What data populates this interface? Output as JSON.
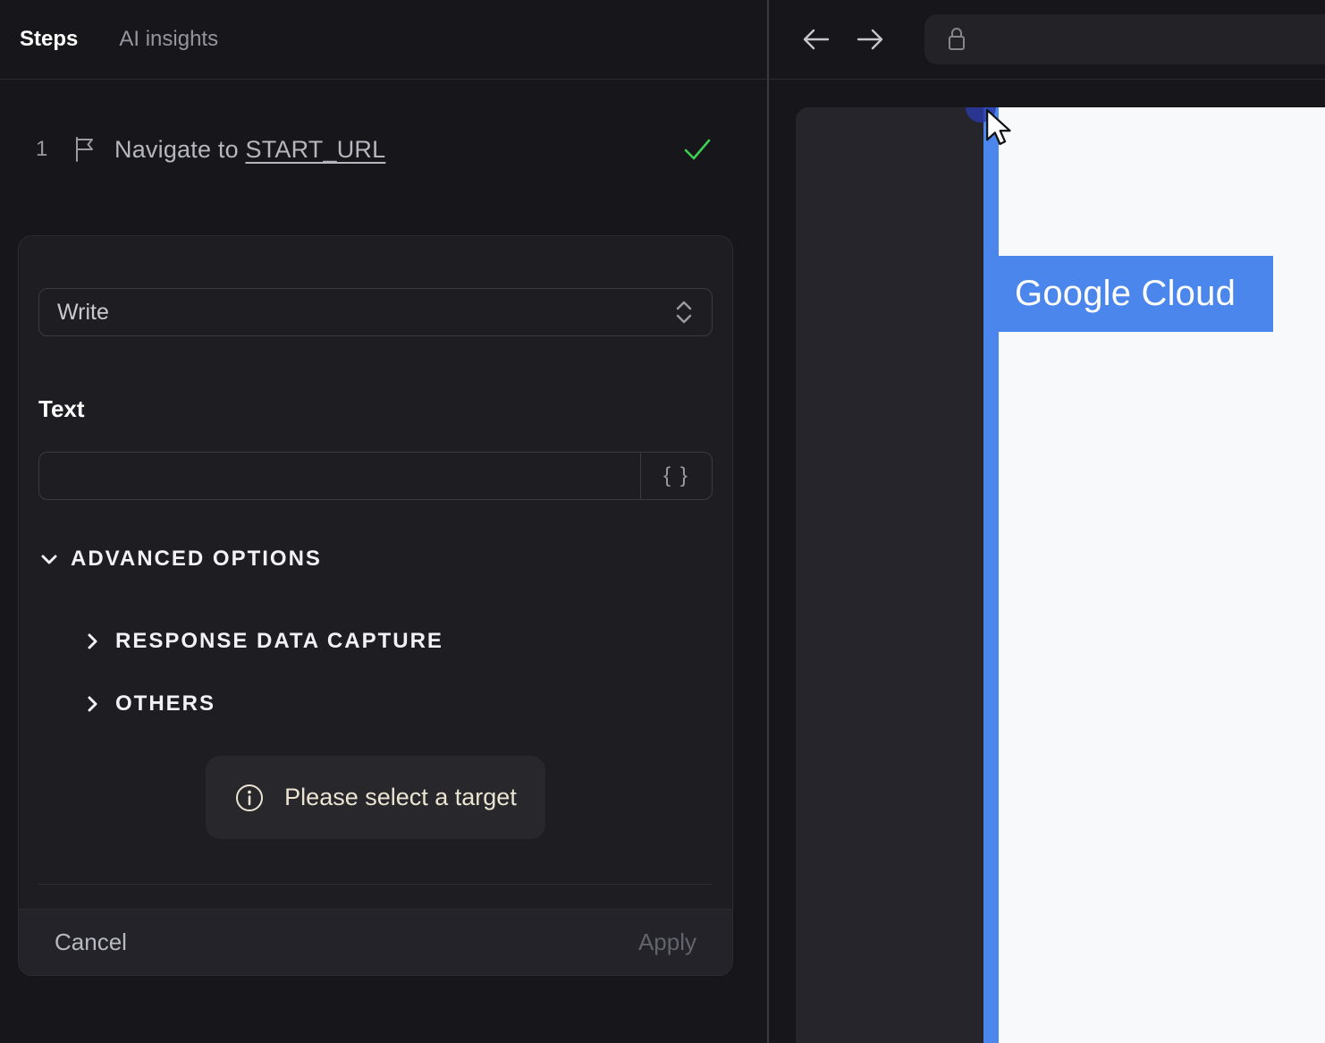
{
  "left_panel": {
    "tabs": {
      "steps": "Steps",
      "ai_insights": "AI insights"
    },
    "step": {
      "number": "1",
      "action": "Navigate to ",
      "target": "START_URL"
    },
    "form": {
      "action_value": "Write",
      "text_label": "Text",
      "text_value": "",
      "variable_button": "{ }",
      "advanced_options": "ADVANCED OPTIONS",
      "response_data_capture": "RESPONSE DATA CAPTURE",
      "others": "OTHERS",
      "tooltip": "Please select a target",
      "cancel": "Cancel",
      "apply": "Apply"
    }
  },
  "browser_panel": {
    "url": "",
    "page": {
      "brand": "Google Cloud"
    }
  },
  "colors": {
    "accent_blue": "#4a86ec",
    "success_green": "#3ecf50",
    "tooltip_text": "#ece4d2",
    "site_page_bg": "#f8f9fa",
    "site_sidebar_bg": "#25252b"
  }
}
